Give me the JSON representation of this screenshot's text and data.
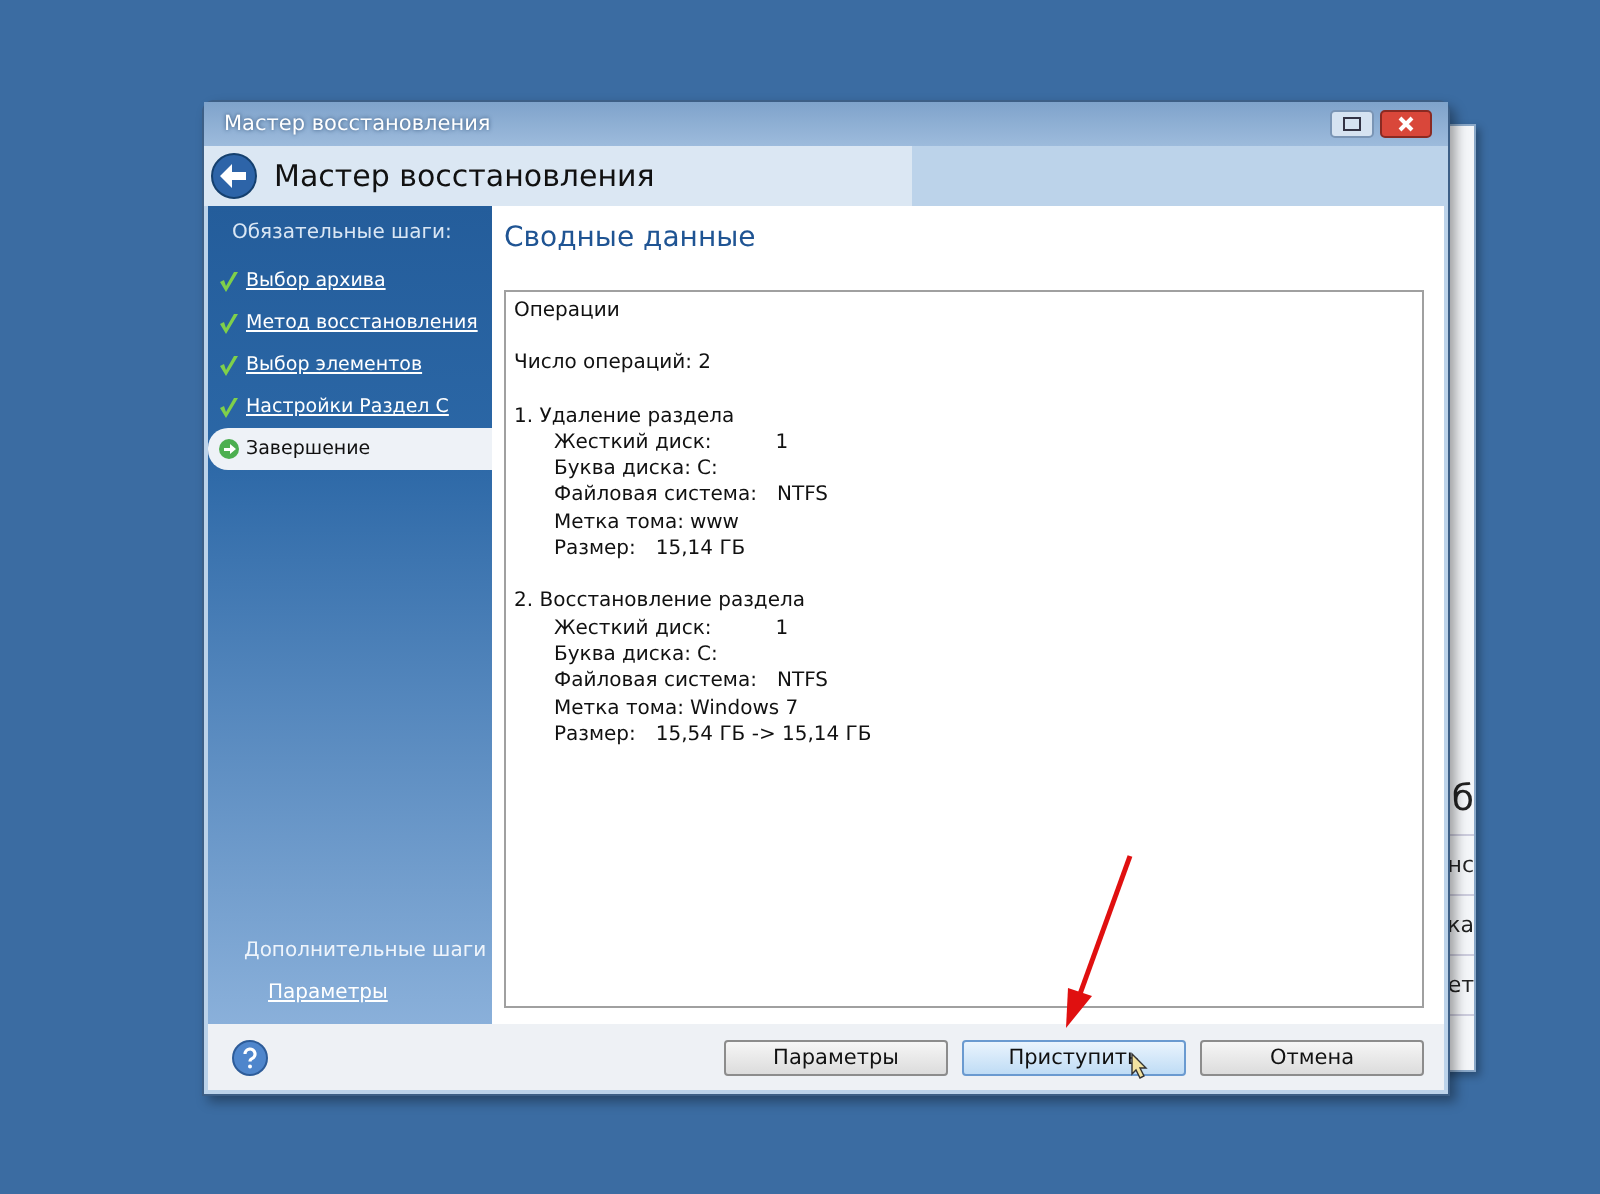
{
  "window": {
    "title": "Мастер восстановления"
  },
  "header": {
    "title": "Мастер восстановления"
  },
  "sidebar": {
    "required_label": "Обязательные шаги:",
    "steps": [
      {
        "label": "Выбор архива",
        "done": true,
        "selected": false
      },
      {
        "label": "Метод восстановления",
        "done": true,
        "selected": false
      },
      {
        "label": "Выбор элементов",
        "done": true,
        "selected": false
      },
      {
        "label": "Настройки Раздел С",
        "done": true,
        "selected": false
      },
      {
        "label": "Завершение",
        "done": false,
        "selected": true
      }
    ],
    "optional_label": "Дополнительные шаги",
    "optional_links": [
      "Параметры"
    ]
  },
  "content": {
    "heading": "Сводные данные",
    "summary": {
      "title": "Операции",
      "count": "Число операций: 2",
      "operations": [
        {
          "title": "1. Удаление раздела",
          "fields": [
            {
              "label": "Жесткий диск:",
              "value": "1",
              "kind": "wide"
            },
            {
              "label": "Буква диска:",
              "value": "C:",
              "kind": "inline"
            },
            {
              "label": "Файловая система:",
              "value": "NTFS",
              "kind": "tab"
            },
            {
              "label": "Метка тома:",
              "value": "www",
              "kind": "inline"
            },
            {
              "label": "Размер:",
              "value": "15,14 ГБ",
              "kind": "tab"
            }
          ]
        },
        {
          "title": "2. Восстановление раздела",
          "fields": [
            {
              "label": "Жесткий диск:",
              "value": "1",
              "kind": "wide"
            },
            {
              "label": "Буква диска:",
              "value": "C:",
              "kind": "inline"
            },
            {
              "label": "Файловая система:",
              "value": "NTFS",
              "kind": "tab"
            },
            {
              "label": "Метка тома:",
              "value": "Windows 7",
              "kind": "inline"
            },
            {
              "label": "Размер:",
              "value": "15,54 ГБ -> 15,14 ГБ",
              "kind": "tab"
            }
          ]
        }
      ]
    }
  },
  "buttons": [
    {
      "label": "Параметры",
      "focused": false
    },
    {
      "label": "Приступить",
      "focused": true
    },
    {
      "label": "Отмена",
      "focused": false
    }
  ],
  "background_window": {
    "fragments": [
      "б",
      "нс",
      "ка",
      "ет"
    ]
  }
}
